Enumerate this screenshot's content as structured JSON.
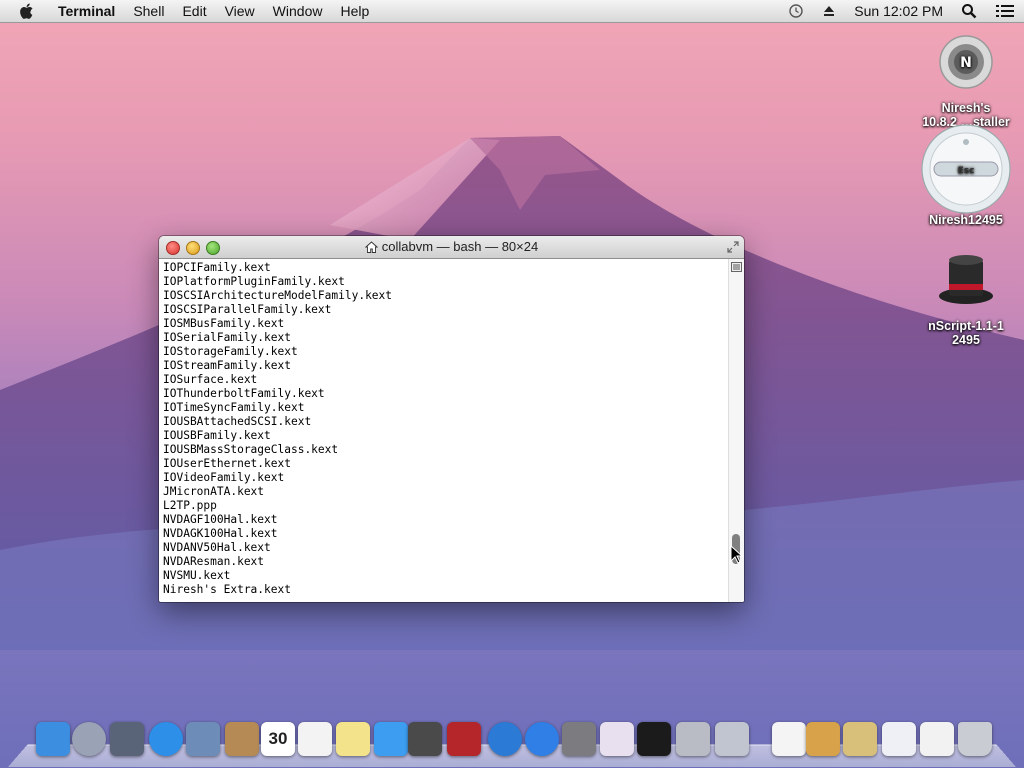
{
  "menubar": {
    "app_name": "Terminal",
    "items": [
      "Shell",
      "Edit",
      "View",
      "Window",
      "Help"
    ],
    "clock": "Sun 12:02 PM"
  },
  "desktop": {
    "icons": [
      {
        "label_line1": "Niresh's",
        "label_line2": "10.8.2 …staller",
        "icon": "installer-disk-icon"
      },
      {
        "label": "Niresh12495",
        "icon": "remote-control-icon",
        "button_label": "Esc"
      },
      {
        "label_line1": "nScript-1.1-1",
        "label_line2": "2495",
        "icon": "top-hat-icon"
      }
    ]
  },
  "terminal": {
    "title": "collabvm — bash — 80×24",
    "lines": [
      "IOPCIFamily.kext",
      "IOPlatformPluginFamily.kext",
      "IOSCSIArchitectureModelFamily.kext",
      "IOSCSIParallelFamily.kext",
      "IOSMBusFamily.kext",
      "IOSerialFamily.kext",
      "IOStorageFamily.kext",
      "IOStreamFamily.kext",
      "IOSurface.kext",
      "IOThunderboltFamily.kext",
      "IOTimeSyncFamily.kext",
      "IOUSBAttachedSCSI.kext",
      "IOUSBFamily.kext",
      "IOUSBMassStorageClass.kext",
      "IOUserEthernet.kext",
      "IOVideoFamily.kext",
      "JMicronATA.kext",
      "L2TP.ppp",
      "NVDAGF100Hal.kext",
      "NVDAGK100Hal.kext",
      "NVDANV50Hal.kext",
      "NVDAResman.kext",
      "NVSMU.kext",
      "Niresh's Extra.kext"
    ]
  },
  "dock": {
    "items": [
      {
        "name": "finder-icon",
        "color": "#3b8ee0"
      },
      {
        "name": "launchpad-icon",
        "color": "#9aa3b5"
      },
      {
        "name": "mission-control-icon",
        "color": "#5a6478"
      },
      {
        "name": "safari-icon",
        "color": "#2d8fe8"
      },
      {
        "name": "mail-icon",
        "color": "#6d8db8"
      },
      {
        "name": "contacts-icon",
        "color": "#b58a55"
      },
      {
        "name": "calendar-icon",
        "color": "#ffffff",
        "text": "30"
      },
      {
        "name": "reminders-icon",
        "color": "#f3f3f3"
      },
      {
        "name": "notes-icon",
        "color": "#f3e38a"
      },
      {
        "name": "messages-icon",
        "color": "#3d9df0"
      },
      {
        "name": "facetime-icon",
        "color": "#4a4a4a"
      },
      {
        "name": "photo-booth-icon",
        "color": "#b5262b"
      },
      {
        "name": "itunes-icon",
        "color": "#2b7ad6"
      },
      {
        "name": "app-store-icon",
        "color": "#2f7fe6"
      },
      {
        "name": "system-preferences-icon",
        "color": "#7c7c80"
      },
      {
        "name": "unicorn-icon",
        "color": "#e8e0ef"
      },
      {
        "name": "terminal-icon",
        "color": "#1b1b1b"
      },
      {
        "name": "downloads-icon",
        "color": "#b9bcc4"
      },
      {
        "name": "utility-icon",
        "color": "#c0c5cf"
      },
      {
        "name": "document-icon",
        "color": "#f4f4f4"
      },
      {
        "name": "stack-icon",
        "color": "#d8a24a"
      },
      {
        "name": "stack2-icon",
        "color": "#d9c07a"
      },
      {
        "name": "window-icon",
        "color": "#eef0f5"
      },
      {
        "name": "window2-icon",
        "color": "#f2f2f2"
      },
      {
        "name": "trash-icon",
        "color": "#c9ccd2"
      }
    ]
  }
}
